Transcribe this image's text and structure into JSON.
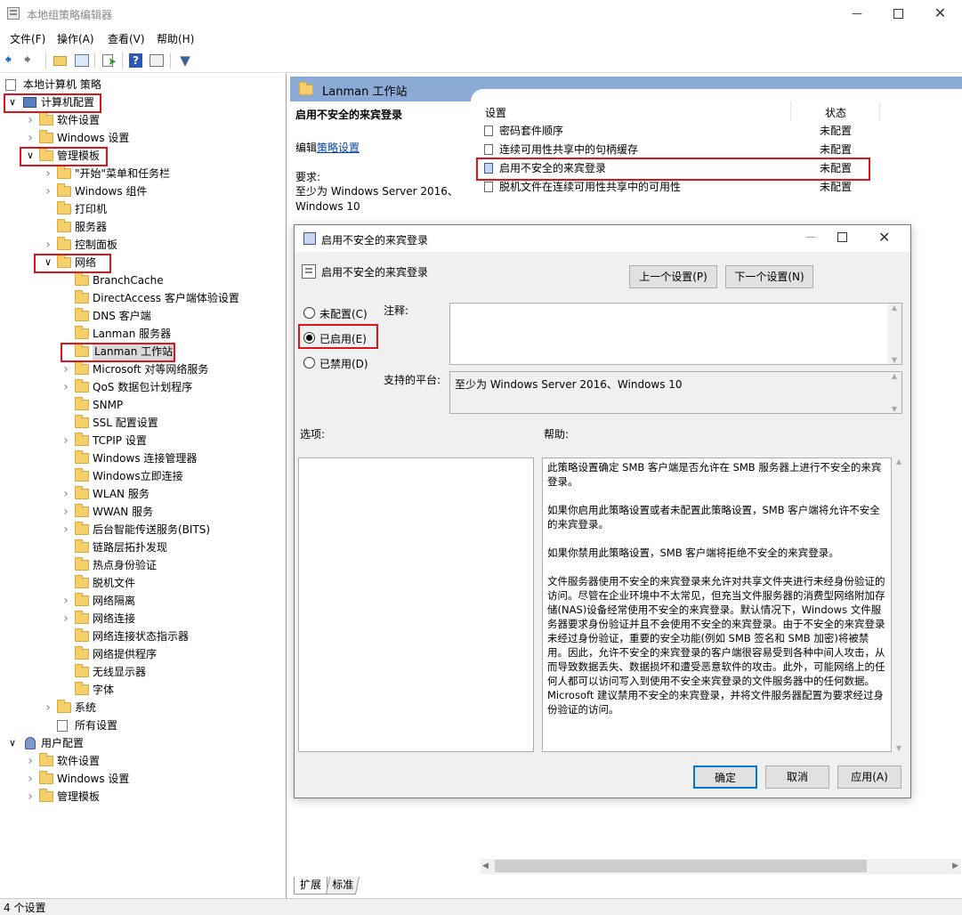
{
  "window": {
    "title": "本地组策略编辑器"
  },
  "menu": [
    "文件(F)",
    "操作(A)",
    "查看(V)",
    "帮助(H)"
  ],
  "tree": {
    "root": "本地计算机 策略",
    "items": [
      {
        "label": "计算机配置",
        "expanded": true
      },
      {
        "label": "软件设置"
      },
      {
        "label": "Windows 设置"
      },
      {
        "label": "管理模板",
        "expanded": true
      },
      {
        "label": "\"开始\"菜单和任务栏"
      },
      {
        "label": "Windows 组件"
      },
      {
        "label": "打印机"
      },
      {
        "label": "服务器"
      },
      {
        "label": "控制面板"
      },
      {
        "label": "网络",
        "expanded": true
      },
      {
        "label": "BranchCache"
      },
      {
        "label": "DirectAccess 客户端体验设置"
      },
      {
        "label": "DNS 客户端"
      },
      {
        "label": "Lanman 服务器"
      },
      {
        "label": "Lanman 工作站",
        "selected": true
      },
      {
        "label": "Microsoft 对等网络服务"
      },
      {
        "label": "QoS 数据包计划程序"
      },
      {
        "label": "SNMP"
      },
      {
        "label": "SSL 配置设置"
      },
      {
        "label": "TCPIP 设置"
      },
      {
        "label": "Windows 连接管理器"
      },
      {
        "label": "Windows立即连接"
      },
      {
        "label": "WLAN 服务"
      },
      {
        "label": "WWAN 服务"
      },
      {
        "label": "后台智能传送服务(BITS)"
      },
      {
        "label": "链路层拓扑发现"
      },
      {
        "label": "热点身份验证"
      },
      {
        "label": "脱机文件"
      },
      {
        "label": "网络隔离"
      },
      {
        "label": "网络连接"
      },
      {
        "label": "网络连接状态指示器"
      },
      {
        "label": "网络提供程序"
      },
      {
        "label": "无线显示器"
      },
      {
        "label": "字体"
      },
      {
        "label": "系统"
      },
      {
        "label": "所有设置"
      },
      {
        "label": "用户配置",
        "expanded": true
      },
      {
        "label": "软件设置"
      },
      {
        "label": "Windows 设置"
      },
      {
        "label": "管理模板"
      }
    ]
  },
  "right": {
    "header": "Lanman 工作站",
    "selected_title": "启用不安全的来宾登录",
    "edit_prefix": "编辑",
    "edit_link": "策略设置",
    "requirement_label": "要求:",
    "requirement_text": "至少为 Windows Server 2016、Windows 10",
    "col_setting": "设置",
    "col_state": "状态",
    "policies": [
      {
        "name": "密码套件顺序",
        "state": "未配置"
      },
      {
        "name": "连续可用性共享中的句柄缓存",
        "state": "未配置"
      },
      {
        "name": "启用不安全的来宾登录",
        "state": "未配置"
      },
      {
        "name": "脱机文件在连续可用性共享中的可用性",
        "state": "未配置"
      }
    ],
    "tabs": [
      "扩展",
      "标准"
    ]
  },
  "dialog": {
    "title": "启用不安全的来宾登录",
    "subtitle": "启用不安全的来宾登录",
    "prev_button": "上一个设置(P)",
    "next_button": "下一个设置(N)",
    "radio_not_configured": "未配置(C)",
    "radio_enabled": "已启用(E)",
    "radio_disabled": "已禁用(D)",
    "selected": "已启用(E)",
    "comment_label": "注释:",
    "platform_label": "支持的平台:",
    "platform_text": "至少为 Windows Server 2016、Windows 10",
    "options_label": "选项:",
    "help_label": "帮助:",
    "help_paragraphs": [
      "此策略设置确定 SMB 客户端是否允许在 SMB 服务器上进行不安全的来宾登录。",
      "如果你启用此策略设置或者未配置此策略设置，SMB 客户端将允许不安全的来宾登录。",
      "如果你禁用此策略设置，SMB 客户端将拒绝不安全的来宾登录。",
      "文件服务器使用不安全的来宾登录来允许对共享文件夹进行未经身份验证的访问。尽管在企业环境中不太常见，但充当文件服务器的消费型网络附加存储(NAS)设备经常使用不安全的来宾登录。默认情况下，Windows 文件服务器要求身份验证并且不会使用不安全的来宾登录。由于不安全的来宾登录未经过身份验证，重要的安全功能(例如 SMB 签名和 SMB 加密)将被禁用。因此，允许不安全的来宾登录的客户端很容易受到各种中间人攻击，从而导致数据丢失、数据损坏和遭受恶意软件的攻击。此外，可能网络上的任何人都可以访问写入到使用不安全来宾登录的文件服务器中的任何数据。Microsoft 建议禁用不安全的来宾登录，并将文件服务器配置为要求经过身份验证的访问。"
    ],
    "ok_button": "确定",
    "cancel_button": "取消",
    "apply_button": "应用(A)"
  },
  "status": "4 个设置"
}
